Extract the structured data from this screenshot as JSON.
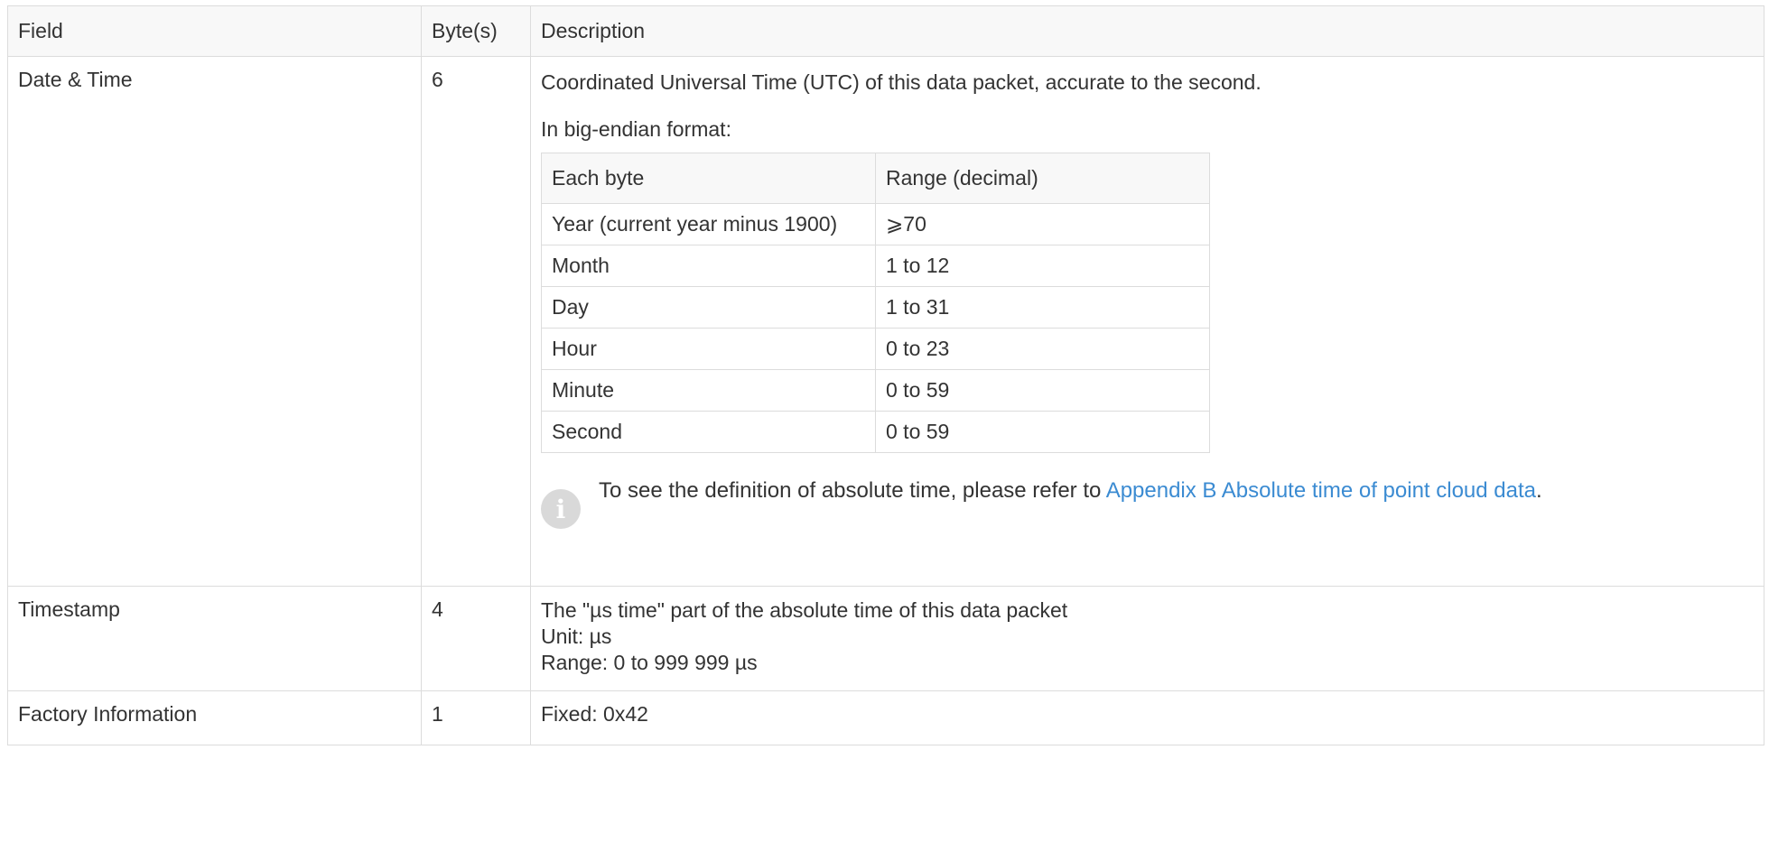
{
  "table": {
    "headers": {
      "field": "Field",
      "bytes": "Byte(s)",
      "description": "Description"
    },
    "date_time": {
      "field": "Date & Time",
      "bytes": "6",
      "intro": "Coordinated Universal Time (UTC) of this data packet, accurate to the second.",
      "format_label": "In big-endian format:",
      "sub_table": {
        "headers": {
          "each_byte": "Each byte",
          "range": "Range (decimal)"
        },
        "rows": [
          {
            "each_byte": "Year (current year minus 1900)",
            "range": "⩾70"
          },
          {
            "each_byte": "Month",
            "range": "1 to 12"
          },
          {
            "each_byte": "Day",
            "range": "1 to 31"
          },
          {
            "each_byte": "Hour",
            "range": "0 to 23"
          },
          {
            "each_byte": "Minute",
            "range": "0 to 59"
          },
          {
            "each_byte": "Second",
            "range": "0 to 59"
          }
        ]
      },
      "note": {
        "icon": "info-icon",
        "icon_glyph": "i",
        "text_before": "To see the definition of absolute time, please refer to ",
        "link_text": "Appendix B Absolute time of point cloud data",
        "text_after": "."
      }
    },
    "timestamp": {
      "field": "Timestamp",
      "bytes": "4",
      "lines": [
        "The \"µs time\" part of the absolute time of this data packet",
        "Unit: µs",
        "Range: 0 to 999 999 µs"
      ]
    },
    "factory_information": {
      "field": "Factory Information",
      "bytes": "1",
      "description": "Fixed: 0x42"
    }
  },
  "colors": {
    "text": "#333333",
    "link": "#3b8bd2",
    "border": "#dcdcdc",
    "header_bg": "#f8f8f8",
    "icon_bg": "#d9d9d9"
  }
}
